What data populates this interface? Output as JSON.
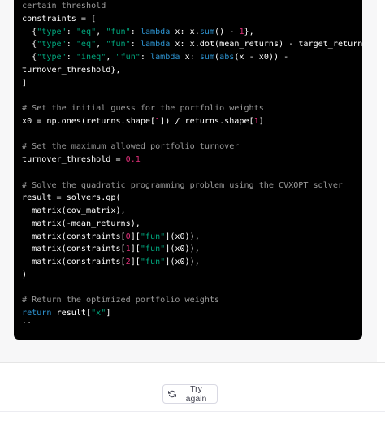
{
  "code_lines": [
    [
      {
        "t": "certain threshold",
        "c": "com"
      }
    ],
    [
      {
        "t": "constraints = [",
        "c": "pl"
      }
    ],
    [
      {
        "t": "  {",
        "c": "pl"
      },
      {
        "t": "\"type\"",
        "c": "str"
      },
      {
        "t": ": ",
        "c": "pl"
      },
      {
        "t": "\"eq\"",
        "c": "str"
      },
      {
        "t": ", ",
        "c": "pl"
      },
      {
        "t": "\"fun\"",
        "c": "str"
      },
      {
        "t": ": ",
        "c": "pl"
      },
      {
        "t": "lambda",
        "c": "kw"
      },
      {
        "t": " x: x.",
        "c": "pl"
      },
      {
        "t": "sum",
        "c": "kw"
      },
      {
        "t": "() - ",
        "c": "pl"
      },
      {
        "t": "1",
        "c": "num"
      },
      {
        "t": "},",
        "c": "pl"
      }
    ],
    [
      {
        "t": "  {",
        "c": "pl"
      },
      {
        "t": "\"type\"",
        "c": "str"
      },
      {
        "t": ": ",
        "c": "pl"
      },
      {
        "t": "\"eq\"",
        "c": "str"
      },
      {
        "t": ", ",
        "c": "pl"
      },
      {
        "t": "\"fun\"",
        "c": "str"
      },
      {
        "t": ": ",
        "c": "pl"
      },
      {
        "t": "lambda",
        "c": "kw"
      },
      {
        "t": " x: x.dot(mean_returns) - target_return},",
        "c": "pl"
      }
    ],
    [
      {
        "t": "  {",
        "c": "pl"
      },
      {
        "t": "\"type\"",
        "c": "str"
      },
      {
        "t": ": ",
        "c": "pl"
      },
      {
        "t": "\"ineq\"",
        "c": "str"
      },
      {
        "t": ", ",
        "c": "pl"
      },
      {
        "t": "\"fun\"",
        "c": "str"
      },
      {
        "t": ": ",
        "c": "pl"
      },
      {
        "t": "lambda",
        "c": "kw"
      },
      {
        "t": " x: ",
        "c": "pl"
      },
      {
        "t": "sum",
        "c": "kw"
      },
      {
        "t": "(",
        "c": "pl"
      },
      {
        "t": "abs",
        "c": "kw"
      },
      {
        "t": "(x - x0)) -",
        "c": "pl"
      }
    ],
    [
      {
        "t": "turnover_threshold},",
        "c": "pl"
      }
    ],
    [
      {
        "t": "]",
        "c": "pl"
      }
    ],
    [],
    [
      {
        "t": "# Set the initial guess for the portfolio weights",
        "c": "com"
      }
    ],
    [
      {
        "t": "x0 = np.ones(returns.shape[",
        "c": "pl"
      },
      {
        "t": "1",
        "c": "num"
      },
      {
        "t": "]) / returns.shape[",
        "c": "pl"
      },
      {
        "t": "1",
        "c": "num"
      },
      {
        "t": "]",
        "c": "pl"
      }
    ],
    [],
    [
      {
        "t": "# Set the maximum allowed portfolio turnover",
        "c": "com"
      }
    ],
    [
      {
        "t": "turnover_threshold = ",
        "c": "pl"
      },
      {
        "t": "0.1",
        "c": "num"
      }
    ],
    [],
    [
      {
        "t": "# Solve the quadratic programming problem using the CVXOPT solver",
        "c": "com"
      }
    ],
    [
      {
        "t": "result = solvers.qp(",
        "c": "pl"
      }
    ],
    [
      {
        "t": "  matrix(cov_matrix),",
        "c": "pl"
      }
    ],
    [
      {
        "t": "  matrix(-mean_returns),",
        "c": "pl"
      }
    ],
    [
      {
        "t": "  matrix(constraints[",
        "c": "pl"
      },
      {
        "t": "0",
        "c": "num"
      },
      {
        "t": "][",
        "c": "pl"
      },
      {
        "t": "\"fun\"",
        "c": "str"
      },
      {
        "t": "](x0)),",
        "c": "pl"
      }
    ],
    [
      {
        "t": "  matrix(constraints[",
        "c": "pl"
      },
      {
        "t": "1",
        "c": "num"
      },
      {
        "t": "][",
        "c": "pl"
      },
      {
        "t": "\"fun\"",
        "c": "str"
      },
      {
        "t": "](x0)),",
        "c": "pl"
      }
    ],
    [
      {
        "t": "  matrix(constraints[",
        "c": "pl"
      },
      {
        "t": "2",
        "c": "num"
      },
      {
        "t": "][",
        "c": "pl"
      },
      {
        "t": "\"fun\"",
        "c": "str"
      },
      {
        "t": "](x0)),",
        "c": "pl"
      }
    ],
    [
      {
        "t": ")",
        "c": "pl"
      }
    ],
    [],
    [
      {
        "t": "# Return the optimized portfolio weights",
        "c": "com"
      }
    ],
    [
      {
        "t": "return",
        "c": "kw"
      },
      {
        "t": " result[",
        "c": "pl"
      },
      {
        "t": "\"x\"",
        "c": "str"
      },
      {
        "t": "]",
        "c": "pl"
      }
    ],
    [
      {
        "t": "``",
        "c": "pl"
      }
    ]
  ],
  "colors": {
    "code_background": "#000000",
    "comment": "#9b9b9b",
    "string": "#00a67d",
    "keyword": "#2e95d3",
    "number": "#df3079",
    "plain": "#ffffff"
  },
  "try_again": {
    "label": "Try again",
    "icon": "refresh-icon"
  }
}
